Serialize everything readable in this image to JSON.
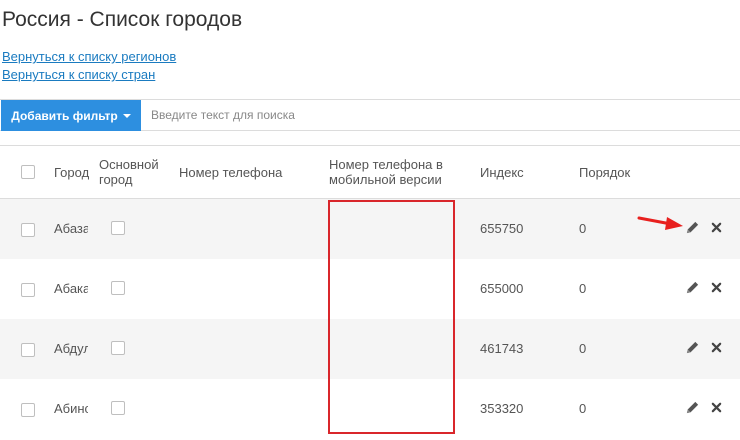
{
  "page": {
    "title": "Россия - Список городов"
  },
  "links": {
    "back_regions": "Вернуться к списку регионов",
    "back_countries": "Вернуться к списку стран"
  },
  "toolbar": {
    "filter_label": "Добавить фильтр",
    "search_placeholder": "Введите текст для поиска"
  },
  "table": {
    "headers": {
      "city": "Город",
      "main_city": "Основной город",
      "phone": "Номер телефона",
      "mobile_phone": "Номер телефона в мобильной версии",
      "index": "Индекс",
      "order": "Порядок"
    },
    "rows": [
      {
        "city": "Абаза",
        "phone": "",
        "mobile_phone": "",
        "index": "655750",
        "order": "0"
      },
      {
        "city": "Абакан",
        "phone": "",
        "mobile_phone": "",
        "index": "655000",
        "order": "0"
      },
      {
        "city": "Абдулино",
        "phone": "",
        "mobile_phone": "",
        "index": "461743",
        "order": "0"
      },
      {
        "city": "Абинск",
        "phone": "",
        "mobile_phone": "",
        "index": "353320",
        "order": "0"
      }
    ]
  },
  "icons": {
    "edit": "pencil-icon",
    "delete": "close-icon",
    "annotation_arrow": "red-arrow-icon"
  },
  "colors": {
    "accent": "#2d8fe0",
    "link": "#1a7bc0",
    "annotation": "#d9262b"
  }
}
